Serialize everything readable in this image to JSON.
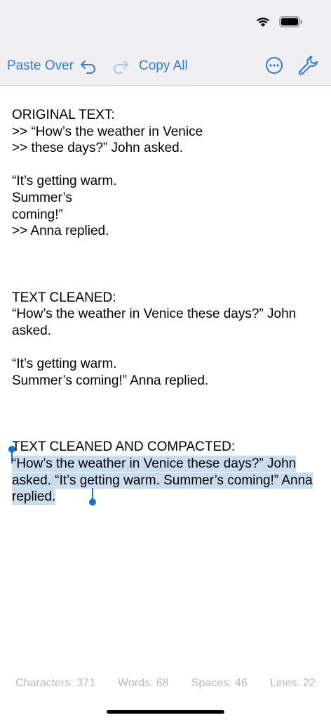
{
  "toolbar": {
    "paste_over_label": "Paste Over",
    "copy_all_label": "Copy All",
    "undo_icon": "undo-arrow",
    "redo_icon": "redo-arrow",
    "more_icon": "ellipsis-circle",
    "tools_icon": "wrench"
  },
  "document": {
    "original_heading": "ORIGINAL TEXT:",
    "original_lines": ">> “How’s the weather in Venice\n>> these days?” John asked.",
    "original_lines_2": "“It’s getting warm.\nSummer’s\ncoming!”\n>> Anna replied.",
    "cleaned_heading": "TEXT CLEANED:",
    "cleaned_para_1": "“How’s the weather in Venice these days?” John asked.",
    "cleaned_para_2": "“It’s getting warm.\nSummer’s coming!” Anna replied.",
    "compacted_heading": "TEXT CLEANED AND COMPACTED:",
    "compacted_text": "“How’s the weather in Venice these days?” John asked. “It’s getting warm. Summer’s coming!” Anna replied."
  },
  "stats": {
    "characters": "Characters: 371",
    "words": "Words: 68",
    "spaces": "Spaces: 46",
    "lines": "Lines: 22"
  },
  "colors": {
    "accent": "#2f7be0",
    "selection": "#c9ddef",
    "handle": "#1a6fd6",
    "stats_text": "#b8b8bd"
  }
}
